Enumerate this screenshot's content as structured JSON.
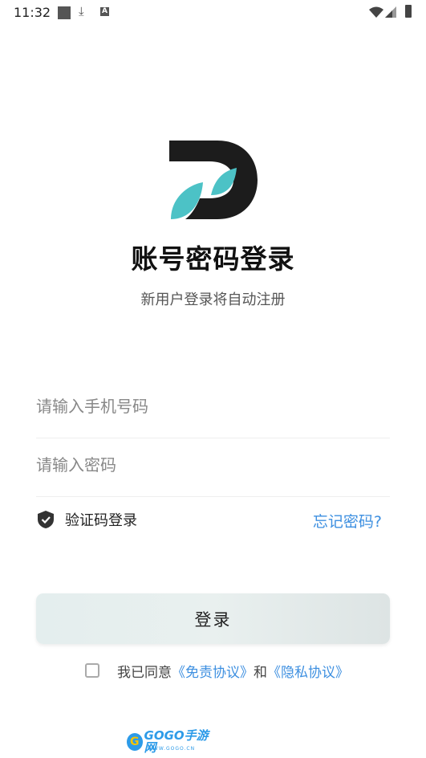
{
  "status_bar": {
    "time": "11:32",
    "notification_icons": [
      "square-icon",
      "download-icon",
      "a-icon"
    ],
    "system_icons": [
      "wifi-icon",
      "signal-icon",
      "battery-icon"
    ]
  },
  "logo": {
    "icon": "d-logo-icon",
    "colors": {
      "dark": "#1c1c1c",
      "accent": "#4cc2c6"
    }
  },
  "header": {
    "title": "账号密码登录",
    "subtitle": "新用户登录将自动注册"
  },
  "form": {
    "phone": {
      "value": "",
      "placeholder": "请输入手机号码"
    },
    "password": {
      "value": "",
      "placeholder": "请输入密码"
    },
    "sms_login_label": "验证码登录",
    "forgot_password": "忘记密码?"
  },
  "login_button": {
    "label": "登录"
  },
  "agreement": {
    "prefix": "我已同意",
    "disclaimer_link": "《免责协议》",
    "conjunction": "和",
    "privacy_link": "《隐私协议》",
    "checked": false
  },
  "watermark": {
    "text": "GOGO手游网",
    "sub": "WWW.GOGO.CN"
  },
  "colors": {
    "link": "#3d8fe0",
    "button_bg": "#e6eeee"
  }
}
